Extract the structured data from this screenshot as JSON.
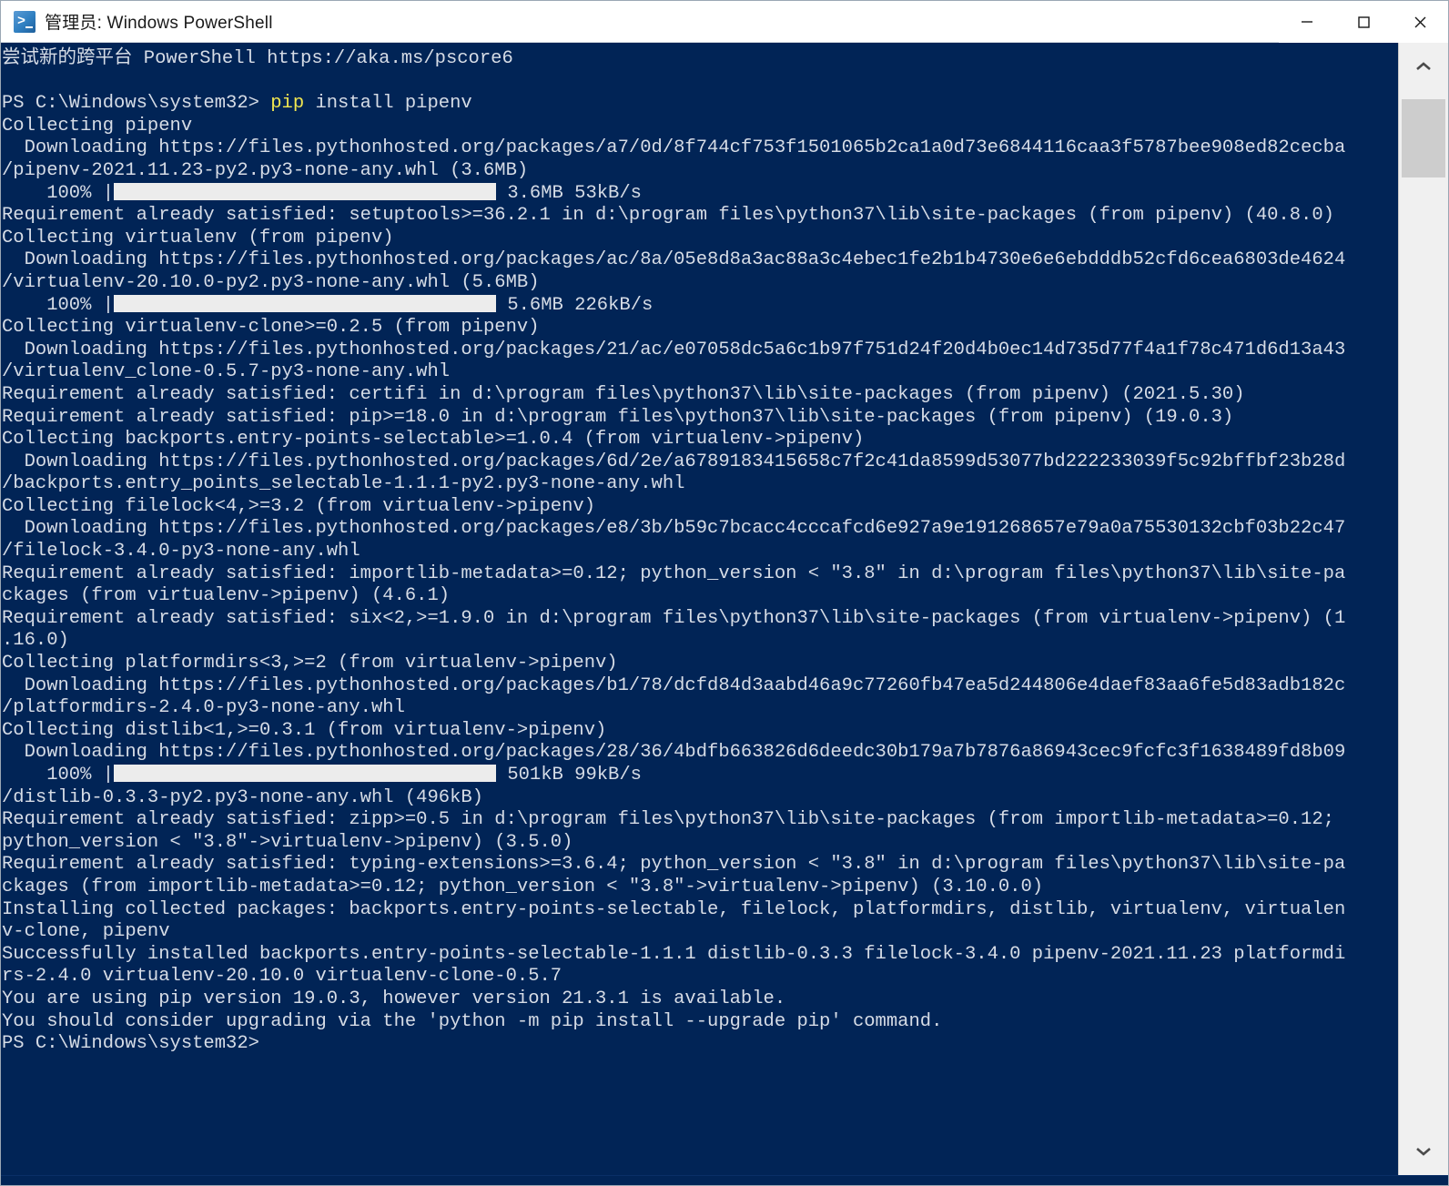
{
  "window": {
    "title": "管理员: Windows PowerShell",
    "icon": "powershell-icon",
    "background_color": "#012456",
    "foreground_color": "#d6dce6",
    "accent_color": "#f2e750",
    "controls": {
      "minimize": "—",
      "maximize": "□",
      "close": "✕"
    }
  },
  "scrollbar": {
    "up_arrow": "▲",
    "down_arrow": "▼"
  },
  "terminal": {
    "banner": "尝试新的跨平台 PowerShell https://aka.ms/pscore6",
    "prompt": "PS C:\\Windows\\system32>",
    "command_keyword": "pip",
    "command_args": " install pipenv",
    "final_prompt": "PS C:\\Windows\\system32>",
    "lines": [
      "Collecting pipenv",
      "  Downloading https://files.pythonhosted.org/packages/a7/0d/8f744cf753f1501065b2ca1a0d73e6844116caa3f5787bee908ed82cecba",
      "/pipenv-2021.11.23-py2.py3-none-any.whl (3.6MB)",
      "Requirement already satisfied: setuptools>=36.2.1 in d:\\program files\\python37\\lib\\site-packages (from pipenv) (40.8.0)",
      "Collecting virtualenv (from pipenv)",
      "  Downloading https://files.pythonhosted.org/packages/ac/8a/05e8d8a3ac88a3c4ebec1fe2b1b4730e6e6ebdddb52cfd6cea6803de4624",
      "/virtualenv-20.10.0-py2.py3-none-any.whl (5.6MB)",
      "Collecting virtualenv-clone>=0.2.5 (from pipenv)",
      "  Downloading https://files.pythonhosted.org/packages/21/ac/e07058dc5a6c1b97f751d24f20d4b0ec14d735d77f4a1f78c471d6d13a43",
      "/virtualenv_clone-0.5.7-py3-none-any.whl",
      "Requirement already satisfied: certifi in d:\\program files\\python37\\lib\\site-packages (from pipenv) (2021.5.30)",
      "Requirement already satisfied: pip>=18.0 in d:\\program files\\python37\\lib\\site-packages (from pipenv) (19.0.3)",
      "Collecting backports.entry-points-selectable>=1.0.4 (from virtualenv->pipenv)",
      "  Downloading https://files.pythonhosted.org/packages/6d/2e/a6789183415658c7f2c41da8599d53077bd222233039f5c92bffbf23b28d",
      "/backports.entry_points_selectable-1.1.1-py2.py3-none-any.whl",
      "Collecting filelock<4,>=3.2 (from virtualenv->pipenv)",
      "  Downloading https://files.pythonhosted.org/packages/e8/3b/b59c7bcacc4cccafcd6e927a9e191268657e79a0a75530132cbf03b22c47",
      "/filelock-3.4.0-py3-none-any.whl",
      "Requirement already satisfied: importlib-metadata>=0.12; python_version < \"3.8\" in d:\\program files\\python37\\lib\\site-pa",
      "ckages (from virtualenv->pipenv) (4.6.1)",
      "Requirement already satisfied: six<2,>=1.9.0 in d:\\program files\\python37\\lib\\site-packages (from virtualenv->pipenv) (1",
      ".16.0)",
      "Collecting platformdirs<3,>=2 (from virtualenv->pipenv)",
      "  Downloading https://files.pythonhosted.org/packages/b1/78/dcfd84d3aabd46a9c77260fb47ea5d244806e4daef83aa6fe5d83adb182c",
      "/platformdirs-2.4.0-py3-none-any.whl",
      "Collecting distlib<1,>=0.3.1 (from virtualenv->pipenv)",
      "  Downloading https://files.pythonhosted.org/packages/28/36/4bdfb663826d6deedc30b179a7b7876a86943cec9fcfc3f1638489fd8b09",
      "/distlib-0.3.3-py2.py3-none-any.whl (496kB)",
      "Requirement already satisfied: zipp>=0.5 in d:\\program files\\python37\\lib\\site-packages (from importlib-metadata>=0.12;",
      "python_version < \"3.8\"->virtualenv->pipenv) (3.5.0)",
      "Requirement already satisfied: typing-extensions>=3.6.4; python_version < \"3.8\" in d:\\program files\\python37\\lib\\site-pa",
      "ckages (from importlib-metadata>=0.12; python_version < \"3.8\"->virtualenv->pipenv) (3.10.0.0)",
      "Installing collected packages: backports.entry-points-selectable, filelock, platformdirs, distlib, virtualenv, virtualen",
      "v-clone, pipenv",
      "Successfully installed backports.entry-points-selectable-1.1.1 distlib-0.3.3 filelock-3.4.0 pipenv-2021.11.23 platformdi",
      "rs-2.4.0 virtualenv-20.10.0 virtualenv-clone-0.5.7",
      "You are using pip version 19.0.3, however version 21.3.1 is available.",
      "You should consider upgrading via the 'python -m pip install --upgrade pip' command."
    ],
    "progress_bars": [
      {
        "after_line": 2,
        "percent": "100%",
        "size": "3.6MB",
        "speed": "53kB/s"
      },
      {
        "after_line": 6,
        "percent": "100%",
        "size": "5.6MB",
        "speed": "226kB/s"
      },
      {
        "after_line": 26,
        "percent": "100%",
        "size": "501kB",
        "speed": "99kB/s"
      }
    ]
  }
}
